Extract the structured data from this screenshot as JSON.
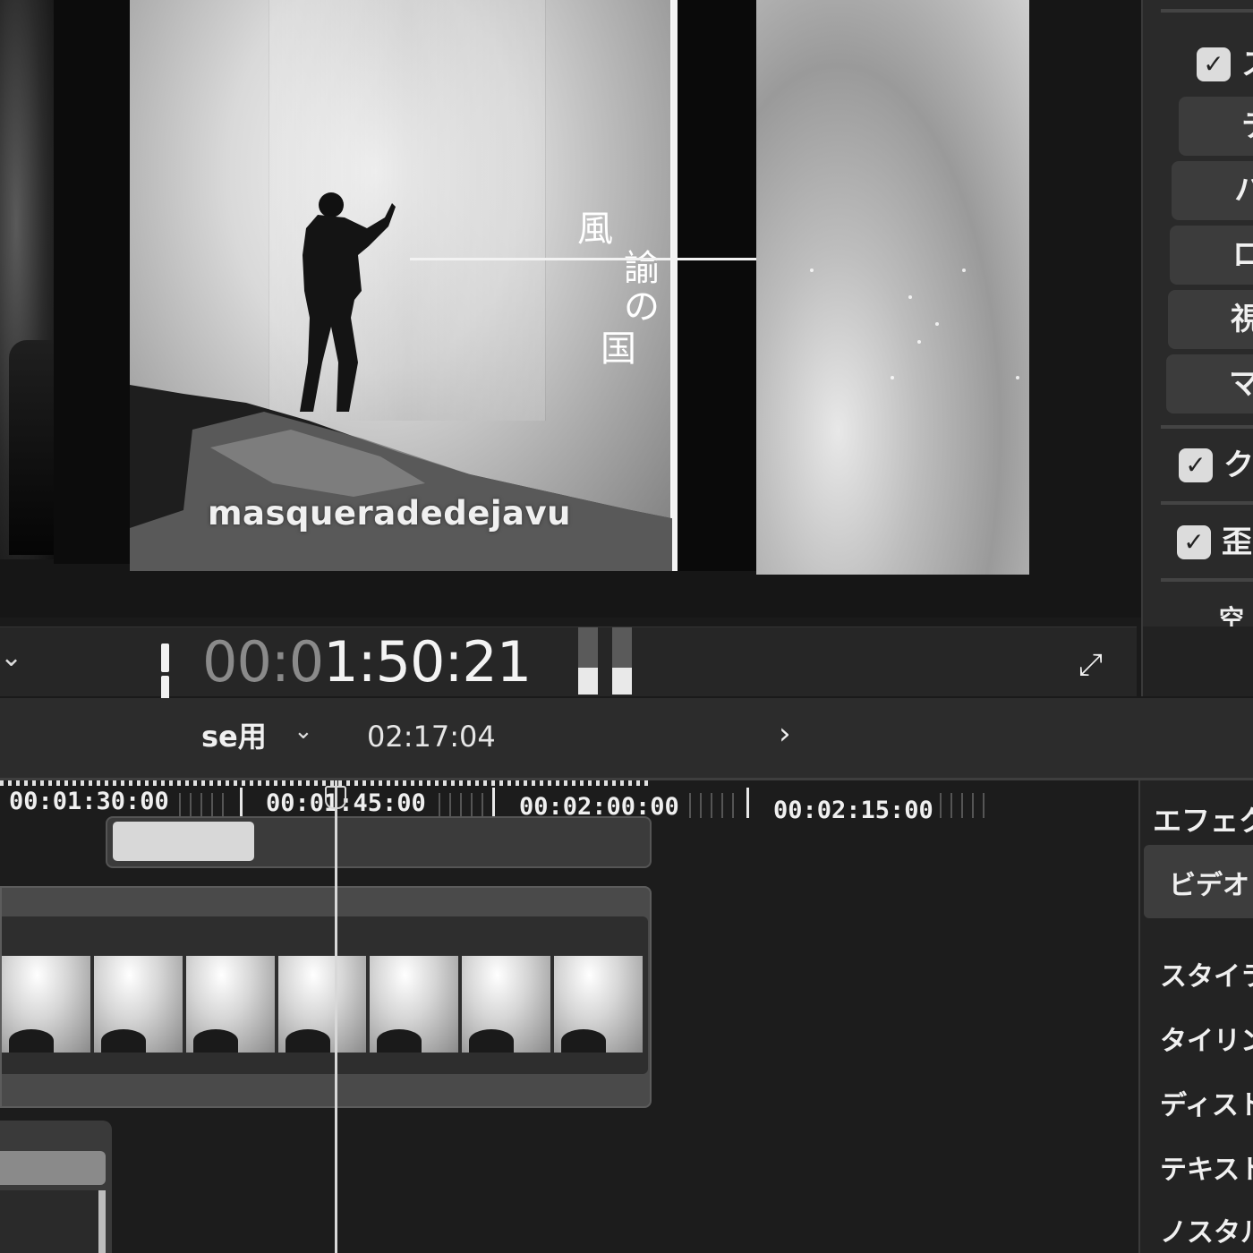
{
  "viewer": {
    "vertical_title": [
      "風",
      "諭",
      "の",
      "国"
    ],
    "watermark_text": "masqueradedejavu"
  },
  "inspector": {
    "checked_rows": [
      {
        "label": "ス",
        "checked": true
      },
      {
        "label": "ク",
        "checked": true
      },
      {
        "label": "歪",
        "checked": true
      }
    ],
    "list_rows": [
      "テ",
      "ハ",
      "ロ",
      "視",
      "マ"
    ],
    "bottom_label": "空間"
  },
  "transport": {
    "timecode_dim": "00:0",
    "timecode_bright": "1:50:21",
    "audio_meter_levels": [
      0.4,
      0.4
    ]
  },
  "timeline_header": {
    "project_name": "se用",
    "duration": "02:17:04"
  },
  "timeline": {
    "ruler_labels": [
      "00:01:30:00",
      "00:01:45:00",
      "00:02:00:00",
      "00:02:15:00"
    ],
    "playhead_timecode": "00:01:50:21"
  },
  "effects_browser": {
    "title": "エフェク",
    "selected_tab": "ビデオ",
    "items": [
      "スタイラ",
      "タイリン",
      "ディスト",
      "テキスト",
      "ノスタル"
    ]
  },
  "colors": {
    "panel_bg": "#262626",
    "accent_text": "#f0f0f0"
  }
}
